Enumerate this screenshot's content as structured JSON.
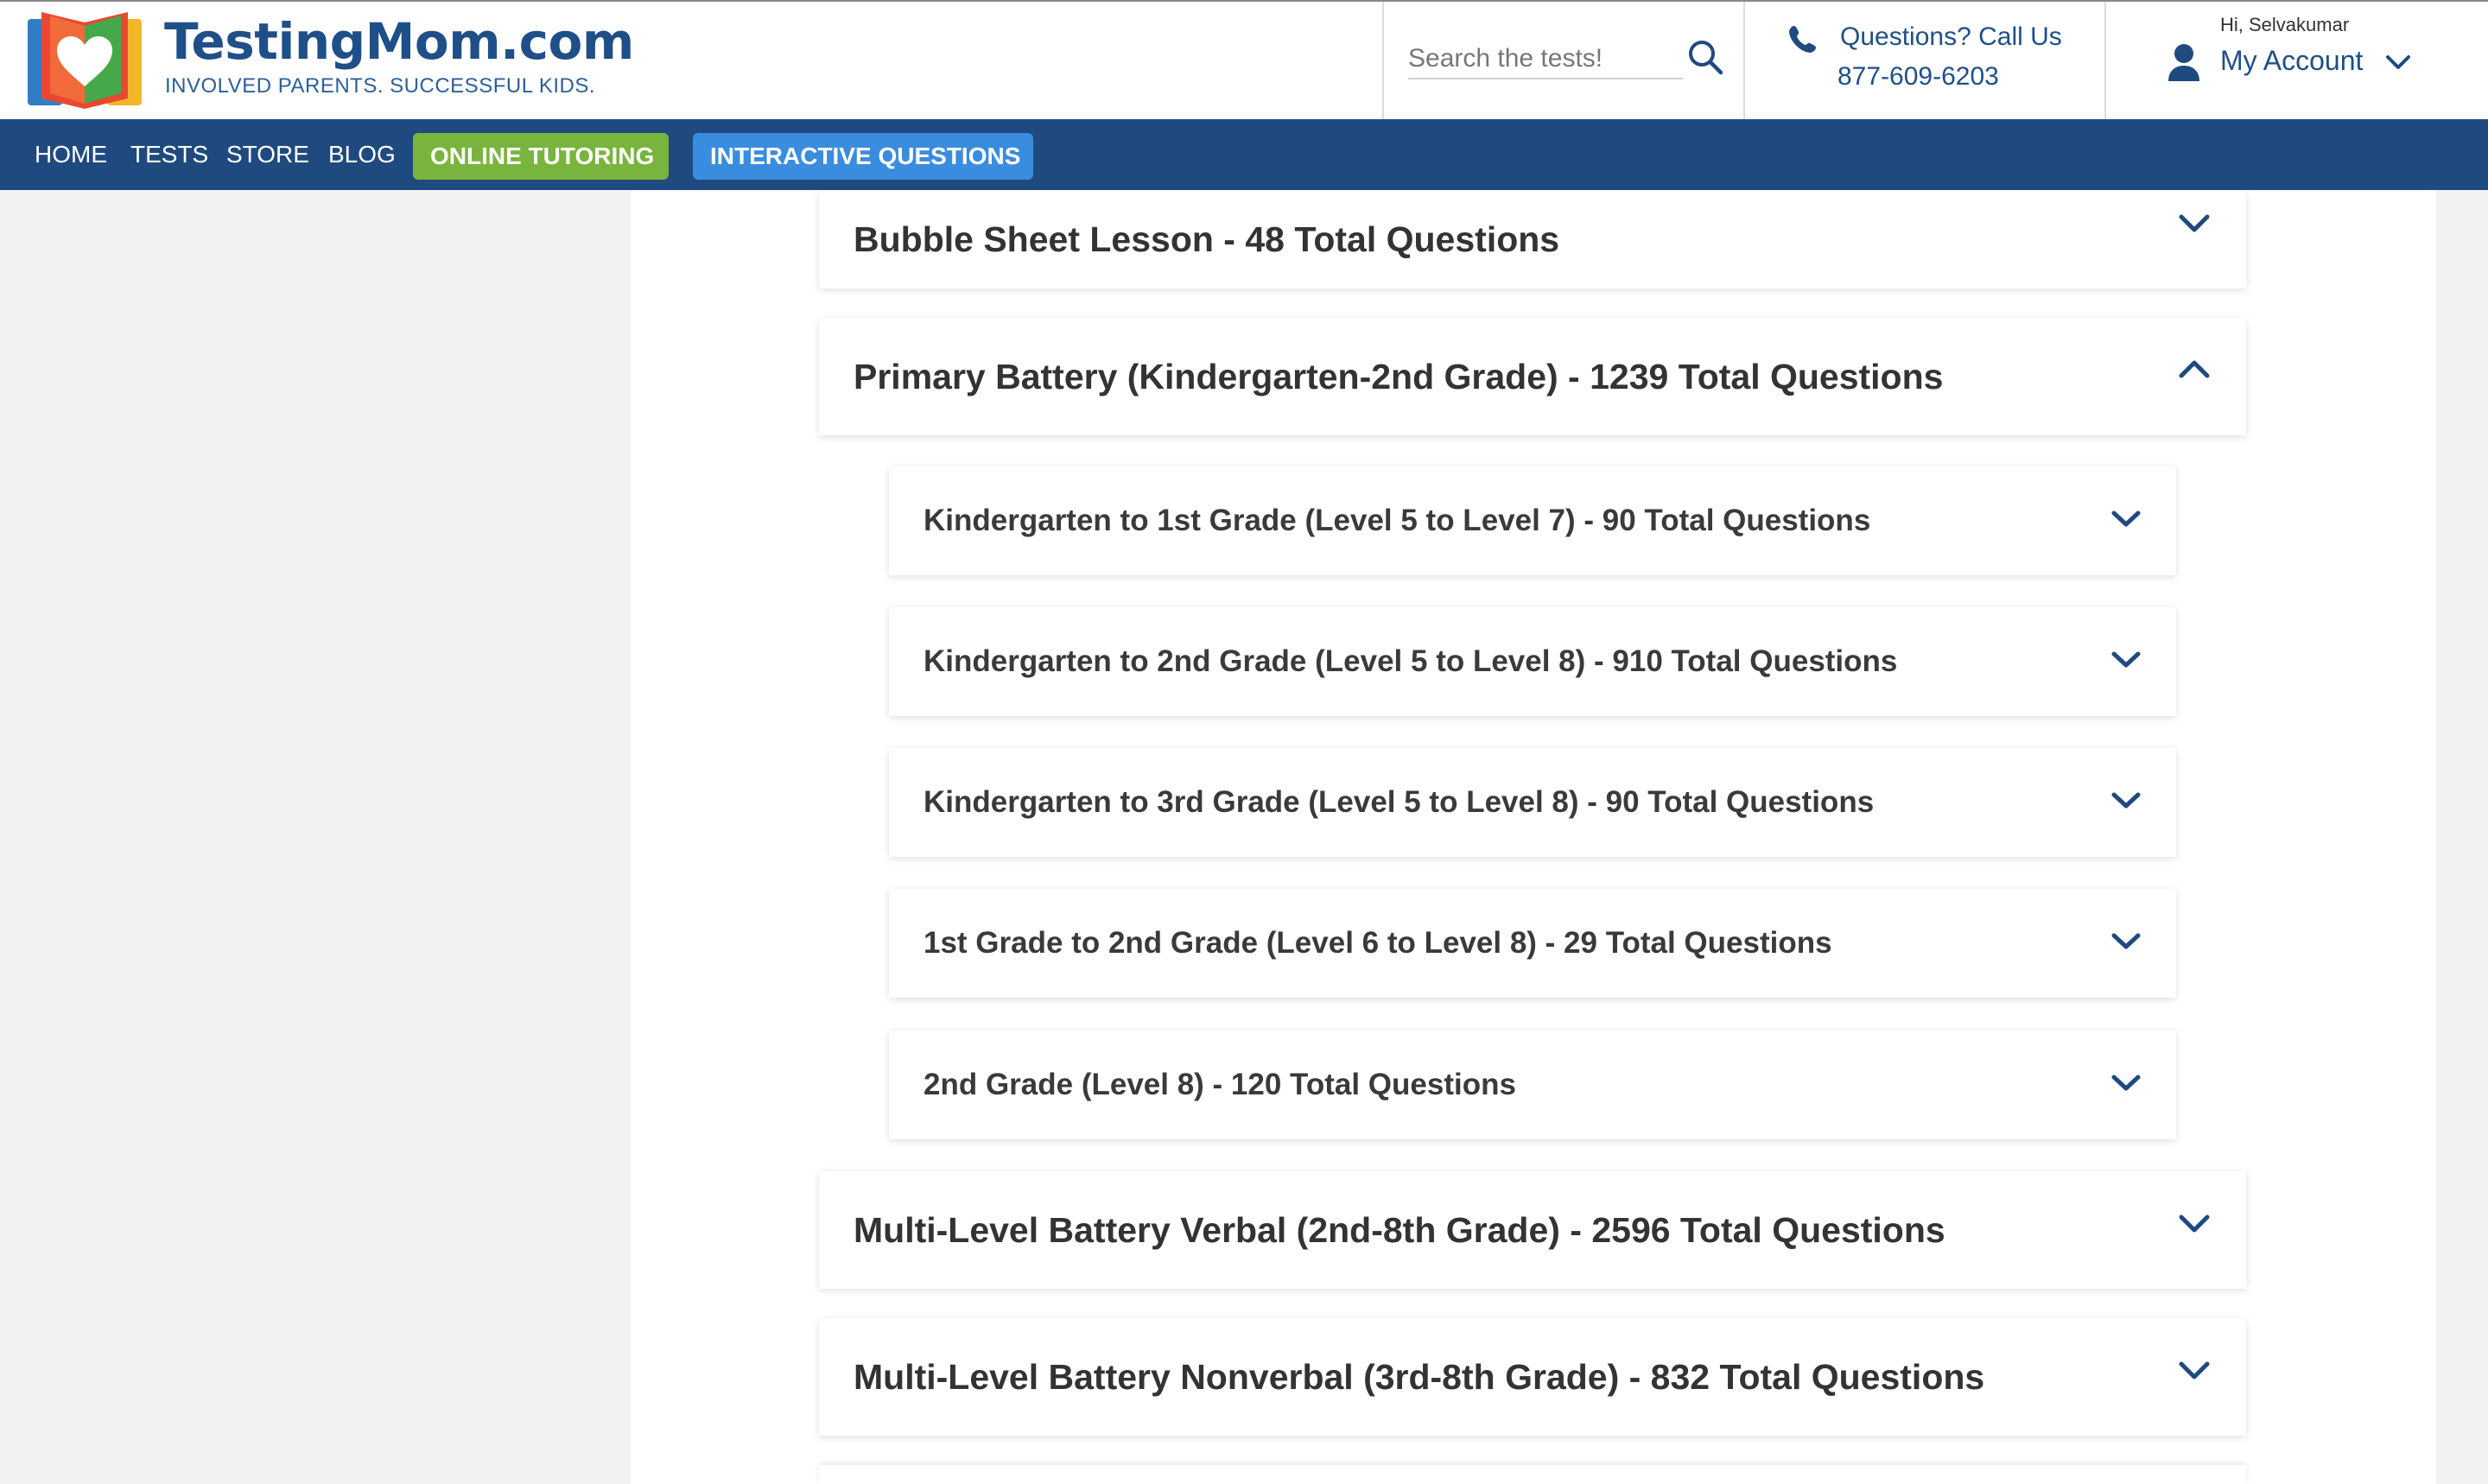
{
  "header": {
    "brand_name": "TestingMom.com",
    "tagline": "INVOLVED PARENTS. SUCCESSFUL KIDS.",
    "search": {
      "placeholder": "Search the tests!"
    },
    "contact": {
      "label": "Questions? Call Us",
      "phone": "877-609-6203"
    },
    "account": {
      "greeting": "Hi, Selvakumar",
      "label": "My Account"
    }
  },
  "nav": {
    "items": [
      "HOME",
      "TESTS",
      "STORE",
      "BLOG"
    ],
    "tutoring": "ONLINE TUTORING",
    "interactive": "INTERACTIVE QUESTIONS"
  },
  "sections": [
    {
      "title": "Bubble Sheet Lesson - 48 Total Questions",
      "expanded": false
    },
    {
      "title": "Primary Battery (Kindergarten-2nd Grade) - 1239 Total Questions",
      "expanded": true,
      "children": [
        {
          "title": "Kindergarten to 1st Grade (Level 5 to Level 7) - 90 Total Questions"
        },
        {
          "title": "Kindergarten to 2nd Grade (Level 5 to Level 8) - 910 Total Questions"
        },
        {
          "title": "Kindergarten to 3rd Grade (Level 5 to Level 8) - 90 Total Questions"
        },
        {
          "title": "1st Grade to 2nd Grade (Level 6 to Level 8) - 29 Total Questions"
        },
        {
          "title": "2nd Grade (Level 8) - 120 Total Questions"
        }
      ]
    },
    {
      "title": "Multi-Level Battery Verbal (2nd-8th Grade) - 2596 Total Questions",
      "expanded": false
    },
    {
      "title": "Multi-Level Battery Nonverbal (3rd-8th Grade) - 832 Total Questions",
      "expanded": false
    }
  ],
  "colors": {
    "brand_blue": "#1f4a7f",
    "tutoring_green": "#79b43e",
    "interactive_blue": "#3a8cde",
    "chevron": "#1f4a7f"
  },
  "icons": [
    "logo-icon",
    "search-icon",
    "phone-icon",
    "user-icon",
    "chevron-down-icon",
    "chevron-up-icon"
  ]
}
